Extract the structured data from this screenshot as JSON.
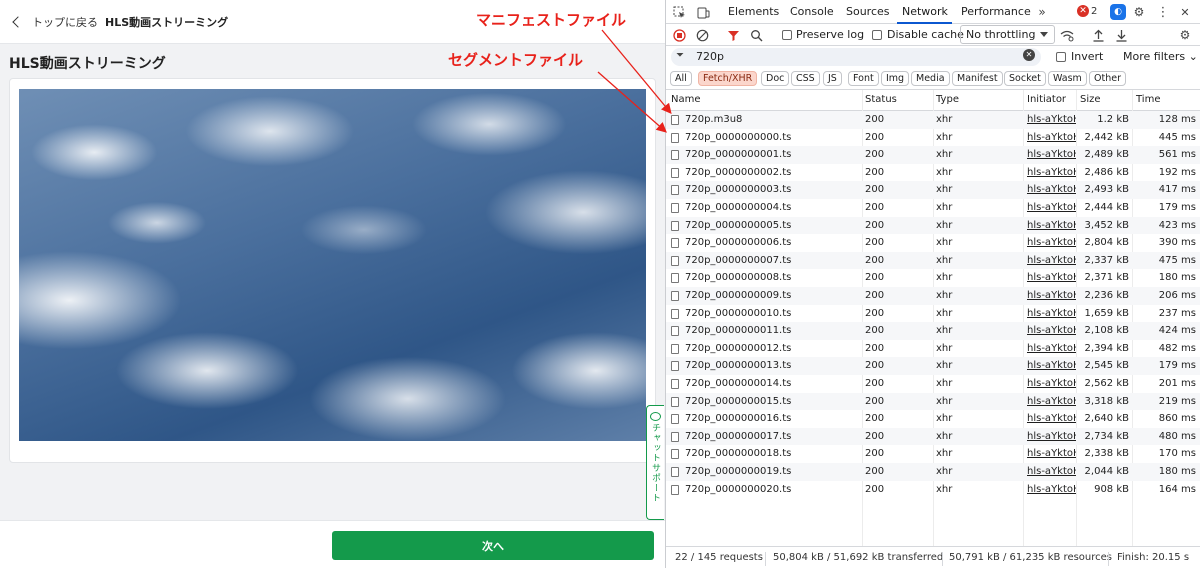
{
  "app": {
    "back_label": "トップに戻る",
    "header_title": "HLS動画ストリーミング",
    "page_title": "HLS動画ストリーミング",
    "next_button": "次へ",
    "chat_support": "チャットサポート"
  },
  "annotations": {
    "manifest": "マニフェストファイル",
    "segment": "セグメントファイル",
    "color": "#e8221b"
  },
  "devtools": {
    "tabs": [
      "Elements",
      "Console",
      "Sources",
      "Network",
      "Performance"
    ],
    "active_tab": "Network",
    "error_count": "2",
    "toolbar": {
      "preserve_log": "Preserve log",
      "disable_cache": "Disable cache",
      "throttling": "No throttling"
    },
    "filter": {
      "value": "720p",
      "invert": "Invert",
      "more_filters": "More filters"
    },
    "type_filters": [
      "All",
      "Fetch/XHR",
      "Doc",
      "CSS",
      "JS",
      "Font",
      "Img",
      "Media",
      "Manifest",
      "Socket",
      "Wasm",
      "Other"
    ],
    "active_type_filter": "Fetch/XHR",
    "columns": [
      "Name",
      "Status",
      "Type",
      "Initiator",
      "Size",
      "Time"
    ],
    "rows": [
      {
        "name": "720p.m3u8",
        "status": "200",
        "type": "xhr",
        "initiator": "hls-aYktoH",
        "size": "1.2 kB",
        "time": "128 ms"
      },
      {
        "name": "720p_0000000000.ts",
        "status": "200",
        "type": "xhr",
        "initiator": "hls-aYktoH",
        "size": "2,442 kB",
        "time": "445 ms"
      },
      {
        "name": "720p_0000000001.ts",
        "status": "200",
        "type": "xhr",
        "initiator": "hls-aYktoH",
        "size": "2,489 kB",
        "time": "561 ms"
      },
      {
        "name": "720p_0000000002.ts",
        "status": "200",
        "type": "xhr",
        "initiator": "hls-aYktoH",
        "size": "2,486 kB",
        "time": "192 ms"
      },
      {
        "name": "720p_0000000003.ts",
        "status": "200",
        "type": "xhr",
        "initiator": "hls-aYktoH",
        "size": "2,493 kB",
        "time": "417 ms"
      },
      {
        "name": "720p_0000000004.ts",
        "status": "200",
        "type": "xhr",
        "initiator": "hls-aYktoH",
        "size": "2,444 kB",
        "time": "179 ms"
      },
      {
        "name": "720p_0000000005.ts",
        "status": "200",
        "type": "xhr",
        "initiator": "hls-aYktoH",
        "size": "3,452 kB",
        "time": "423 ms"
      },
      {
        "name": "720p_0000000006.ts",
        "status": "200",
        "type": "xhr",
        "initiator": "hls-aYktoH",
        "size": "2,804 kB",
        "time": "390 ms"
      },
      {
        "name": "720p_0000000007.ts",
        "status": "200",
        "type": "xhr",
        "initiator": "hls-aYktoH",
        "size": "2,337 kB",
        "time": "475 ms"
      },
      {
        "name": "720p_0000000008.ts",
        "status": "200",
        "type": "xhr",
        "initiator": "hls-aYktoH",
        "size": "2,371 kB",
        "time": "180 ms"
      },
      {
        "name": "720p_0000000009.ts",
        "status": "200",
        "type": "xhr",
        "initiator": "hls-aYktoH",
        "size": "2,236 kB",
        "time": "206 ms"
      },
      {
        "name": "720p_0000000010.ts",
        "status": "200",
        "type": "xhr",
        "initiator": "hls-aYktoH",
        "size": "1,659 kB",
        "time": "237 ms"
      },
      {
        "name": "720p_0000000011.ts",
        "status": "200",
        "type": "xhr",
        "initiator": "hls-aYktoH",
        "size": "2,108 kB",
        "time": "424 ms"
      },
      {
        "name": "720p_0000000012.ts",
        "status": "200",
        "type": "xhr",
        "initiator": "hls-aYktoH",
        "size": "2,394 kB",
        "time": "482 ms"
      },
      {
        "name": "720p_0000000013.ts",
        "status": "200",
        "type": "xhr",
        "initiator": "hls-aYktoH",
        "size": "2,545 kB",
        "time": "179 ms"
      },
      {
        "name": "720p_0000000014.ts",
        "status": "200",
        "type": "xhr",
        "initiator": "hls-aYktoH",
        "size": "2,562 kB",
        "time": "201 ms"
      },
      {
        "name": "720p_0000000015.ts",
        "status": "200",
        "type": "xhr",
        "initiator": "hls-aYktoH",
        "size": "3,318 kB",
        "time": "219 ms"
      },
      {
        "name": "720p_0000000016.ts",
        "status": "200",
        "type": "xhr",
        "initiator": "hls-aYktoH",
        "size": "2,640 kB",
        "time": "860 ms"
      },
      {
        "name": "720p_0000000017.ts",
        "status": "200",
        "type": "xhr",
        "initiator": "hls-aYktoH",
        "size": "2,734 kB",
        "time": "480 ms"
      },
      {
        "name": "720p_0000000018.ts",
        "status": "200",
        "type": "xhr",
        "initiator": "hls-aYktoH",
        "size": "2,338 kB",
        "time": "170 ms"
      },
      {
        "name": "720p_0000000019.ts",
        "status": "200",
        "type": "xhr",
        "initiator": "hls-aYktoH",
        "size": "2,044 kB",
        "time": "180 ms"
      },
      {
        "name": "720p_0000000020.ts",
        "status": "200",
        "type": "xhr",
        "initiator": "hls-aYktoH",
        "size": "908 kB",
        "time": "164 ms"
      }
    ],
    "status_bar": {
      "requests": "22 / 145 requests",
      "transferred": "50,804 kB / 51,692 kB transferred",
      "resources": "50,791 kB / 61,235 kB resources",
      "finish": "Finish: 20.15 s"
    }
  }
}
